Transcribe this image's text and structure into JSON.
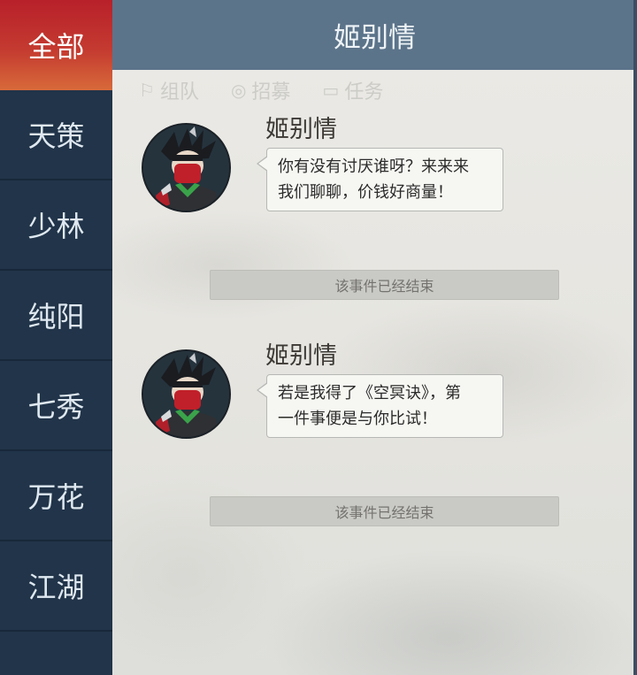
{
  "sidebar": {
    "items": [
      {
        "label": "全部",
        "active": true
      },
      {
        "label": "天策",
        "active": false
      },
      {
        "label": "少林",
        "active": false
      },
      {
        "label": "纯阳",
        "active": false
      },
      {
        "label": "七秀",
        "active": false
      },
      {
        "label": "万花",
        "active": false
      },
      {
        "label": "江湖",
        "active": false
      }
    ]
  },
  "header": {
    "title": "姬别情"
  },
  "background_tabs": [
    {
      "icon": "flag-icon",
      "label": "组队"
    },
    {
      "icon": "target-icon",
      "label": "招募"
    },
    {
      "icon": "scroll-icon",
      "label": "任务"
    }
  ],
  "messages": [
    {
      "speaker": "姬别情",
      "lines": [
        "你有没有讨厌谁呀？来来来",
        "我们聊聊，价钱好商量！"
      ],
      "status": "该事件已经结束"
    },
    {
      "speaker": "姬别情",
      "lines": [
        "若是我得了《空冥诀》，第",
        "一件事便是与你比试！"
      ],
      "status": "该事件已经结束"
    }
  ],
  "colors": {
    "sidebar_bg": "#213449",
    "active_tab": "#c43a30",
    "header_bg": "#5c748a",
    "content_bg": "#e6e5e0",
    "bubble_bg": "#f6f6f2"
  }
}
